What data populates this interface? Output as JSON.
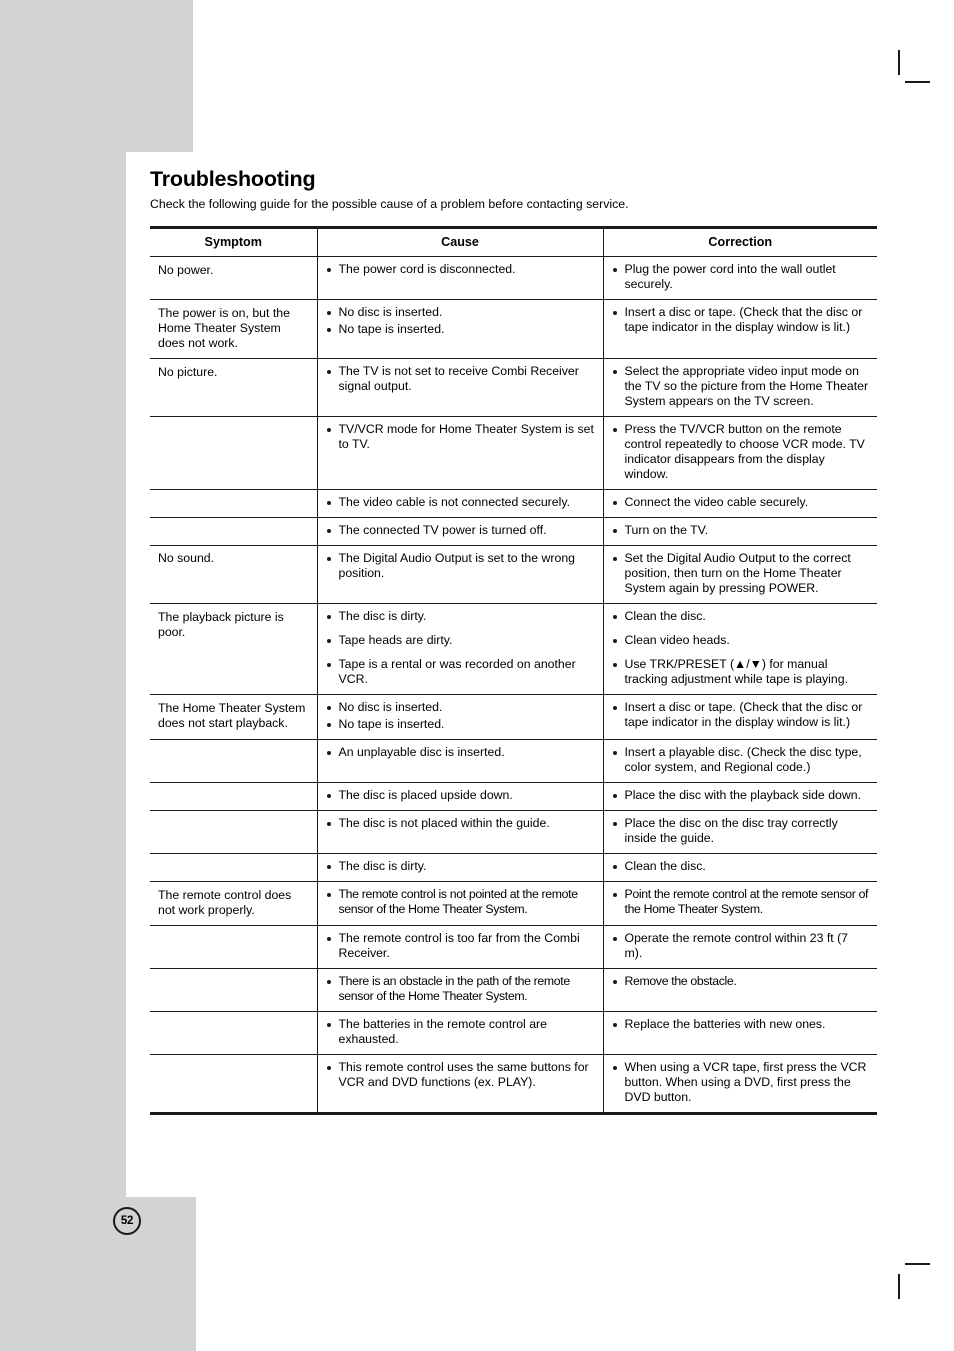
{
  "page": {
    "number": "52",
    "title": "Troubleshooting",
    "intro": "Check the following guide for the possible cause of a problem before contacting service."
  },
  "table": {
    "headers": {
      "symptom": "Symptom",
      "cause": "Cause",
      "correction": "Correction"
    },
    "rows": [
      {
        "symptom": "No power.",
        "causes": [
          "The power cord is disconnected."
        ],
        "corrections": [
          "Plug the power cord into the wall outlet securely."
        ]
      },
      {
        "symptom": "The power is on, but the Home Theater System does not work.",
        "causes": [
          "No disc is inserted.",
          "No tape is inserted."
        ],
        "corrections": [
          "Insert a disc or tape. (Check that the disc or tape indicator in the display window is lit.)"
        ]
      },
      {
        "symptom": "No picture.",
        "causes": [
          "The TV is not set to receive Combi Receiver signal output."
        ],
        "corrections": [
          "Select the appropriate video input mode on the TV so the picture from the Home Theater System appears on the TV screen."
        ]
      },
      {
        "symptom": "",
        "causes": [
          "TV/VCR mode for Home Theater System is set to TV."
        ],
        "corrections": [
          "Press the TV/VCR button on the remote control repeatedly to choose VCR mode. TV indicator disappears from the display window."
        ]
      },
      {
        "symptom": "",
        "causes": [
          "The video cable is not connected securely."
        ],
        "corrections": [
          "Connect the video cable securely."
        ]
      },
      {
        "symptom": "",
        "causes": [
          "The connected TV power is turned off."
        ],
        "corrections": [
          "Turn on the TV."
        ]
      },
      {
        "symptom": "No sound.",
        "causes": [
          "The Digital Audio Output is set to the wrong position."
        ],
        "corrections": [
          "Set the Digital Audio Output to the correct position, then turn on the Home Theater System again by pressing POWER."
        ]
      },
      {
        "symptom": "The playback picture is poor.",
        "causes": [
          "The disc is dirty.",
          "Tape heads are dirty.",
          "Tape is a rental or was recorded on another VCR."
        ],
        "corrections": [
          "Clean the disc.",
          "Clean video heads.",
          "Use TRK/PRESET (▲/▼) for manual tracking adjustment while tape is playing."
        ]
      },
      {
        "symptom": "The Home Theater System does not start playback.",
        "causes": [
          "No disc is inserted.",
          "No tape is inserted."
        ],
        "corrections": [
          "Insert a disc or tape. (Check that the disc or tape indicator in the display window is lit.)"
        ]
      },
      {
        "symptom": "",
        "causes": [
          "An unplayable disc is inserted."
        ],
        "corrections": [
          "Insert a playable disc. (Check the disc type, color system, and Regional code.)"
        ]
      },
      {
        "symptom": "",
        "causes": [
          "The disc is placed upside down."
        ],
        "corrections": [
          "Place the disc with the playback side down."
        ]
      },
      {
        "symptom": "",
        "causes": [
          "The disc is not placed within the guide."
        ],
        "corrections": [
          "Place the disc on the disc tray correctly inside the guide."
        ]
      },
      {
        "symptom": "",
        "causes": [
          "The disc is dirty."
        ],
        "corrections": [
          "Clean the disc."
        ]
      },
      {
        "symptom": "The remote control does not work properly.",
        "causes": [
          "The remote control is not pointed at the remote sensor of the Home Theater System."
        ],
        "corrections": [
          "Point the remote control at the remote sensor of the Home Theater System."
        ]
      },
      {
        "symptom": "",
        "causes": [
          "The remote control is too far from the Combi Receiver."
        ],
        "corrections": [
          "Operate the remote control within 23 ft (7 m)."
        ]
      },
      {
        "symptom": "",
        "causes": [
          "There is an obstacle in the path of the remote sensor of the Home Theater System."
        ],
        "corrections": [
          "Remove the obstacle."
        ]
      },
      {
        "symptom": "",
        "causes": [
          "The batteries in the remote control are exhausted."
        ],
        "corrections": [
          "Replace the batteries with new ones."
        ]
      },
      {
        "symptom": "",
        "causes": [
          "This remote control uses the same buttons for VCR and DVD functions (ex. PLAY)."
        ],
        "corrections": [
          "When using a VCR tape, first press the VCR button. When using a DVD, first press the DVD button."
        ]
      }
    ]
  }
}
